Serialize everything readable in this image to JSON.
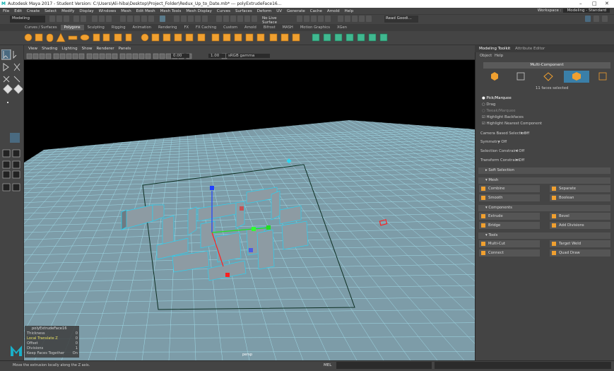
{
  "titlebar": {
    "logo": "M",
    "title": "Autodesk Maya 2017 - Student Version: C:\\Users\\Ali-hiba\\Desktop\\Project_Folder\\Redux_Up_to_Date.mb*  ---  polyExtrudeFace16...",
    "minimize": "–",
    "maximize": "□",
    "close": "✕"
  },
  "menubar": {
    "items": [
      "File",
      "Edit",
      "Create",
      "Select",
      "Modify",
      "Display",
      "Windows",
      "Mesh",
      "Edit Mesh",
      "Mesh Tools",
      "Mesh Display",
      "Curves",
      "Surfaces",
      "Deform",
      "UV",
      "Generate",
      "Cache",
      "Arnold",
      "Help"
    ],
    "workspace_label": "Workspace :",
    "workspace_value": "Modeling - Standard"
  },
  "statusline": {
    "mode": "Modeling",
    "live_surface": "No Live Surface",
    "render_label": "Read Goodi..."
  },
  "shelf": {
    "tabs": [
      "Curves / Surfaces",
      "Polygons",
      "Sculpting",
      "Rigging",
      "Animation",
      "Rendering",
      "FX",
      "FX Caching",
      "Custom",
      "Arnold",
      "Bifrost",
      "MASH",
      "Motion Graphics",
      "XGen"
    ],
    "active_tab": "Polygons",
    "accent": "#f0a030"
  },
  "viewport": {
    "menu": [
      "View",
      "Shading",
      "Lighting",
      "Show",
      "Renderer",
      "Panels"
    ],
    "near_value": "0.00",
    "far_value": "1.00",
    "colorspace": "sRGB gamma",
    "camera_label": "persp"
  },
  "hud": {
    "title": "polyExtrudeFace16",
    "rows": [
      {
        "label": "Thickness",
        "value": "0"
      },
      {
        "label": "Local Translate Z",
        "value": "0"
      },
      {
        "label": "Offset",
        "value": "0"
      },
      {
        "label": "Divisions",
        "value": "1"
      },
      {
        "label": "Keep Faces Together",
        "value": "On"
      }
    ]
  },
  "right_panel": {
    "tabs": [
      "Modeling Toolkit",
      "Attribute Editor"
    ],
    "submenu": [
      "Object",
      "Help"
    ],
    "mode_button": "Multi-Component",
    "faces_selected": "11 faces selected",
    "pick_options": [
      "Pick/Marquee",
      "Drag",
      "Tweak/Marquee"
    ],
    "checks": [
      "Highlight Backfaces",
      "Highlight Nearest Component"
    ],
    "camera_based": {
      "label": "Camera Based Selection",
      "value": "Off"
    },
    "symmetry": {
      "label": "Symmetry",
      "value": "Off"
    },
    "selection_constraint": {
      "label": "Selection Constraint",
      "value": "Off"
    },
    "transform_constraint": {
      "label": "Transform Constraint",
      "value": "Off"
    },
    "soft_selection": "Soft Selection",
    "sections": {
      "mesh": {
        "title": "Mesh",
        "tools": [
          "Combine",
          "Separate",
          "Smooth",
          "Boolean"
        ]
      },
      "components": {
        "title": "Components",
        "tools": [
          "Extrude",
          "Bevel",
          "Bridge",
          "Add Divisions"
        ]
      },
      "tools": {
        "title": "Tools",
        "tools": [
          "Multi-Cut",
          "Target Weld",
          "Connect",
          "Quad Draw"
        ]
      }
    }
  },
  "bottom": {
    "help_text": "Move the extrusion locally along the Z axis.",
    "mel_label": "MEL"
  },
  "colors": {
    "grid": "#6fb9c8",
    "grid_fill": "#7a9aa6",
    "wire": "#25d0f0",
    "wall": "#8d9ba3",
    "manip_x": "#ff2020",
    "manip_y": "#20e020",
    "manip_z": "#2040ff"
  }
}
